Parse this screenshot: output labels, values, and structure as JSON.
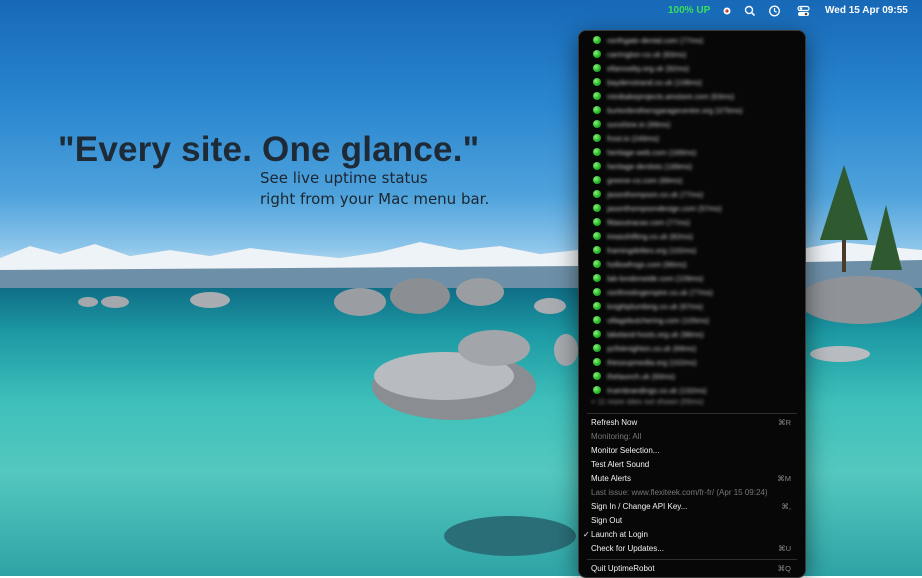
{
  "menubar": {
    "uptime_status": "100% UP",
    "date_time": "Wed 15 Apr  09:55",
    "icons": [
      "app-status-icon",
      "search-icon",
      "time-machine-icon",
      "control-center-icon"
    ]
  },
  "hero": {
    "tagline": "\"Every site. One glance.\"",
    "subline1": "See live uptime status",
    "subline2": "right from your Mac menu bar."
  },
  "monitors": {
    "status_color": "#22c022",
    "sites": [
      "northgate-dental.com (77ms)",
      "carrington-co.uk (83ms)",
      "ellaroseby.org.uk (92ms)",
      "baydenstrand.co.uk (108ms)",
      "minibakeprojects.amstore.com (63ms)",
      "burtonbrothersgaragecentre.org (375ms)",
      "sunshine.io (99ms)",
      "frost.io (249ms)",
      "heritage-web.com (169ms)",
      "heritage-dentists (189ms)",
      "greene-co.com (89ms)",
      "jasonthompson.co.uk (77ms)",
      "jasonthompsondesign.com (57ms)",
      "fittaoutracao.com (77ms)",
      "treasshifting.co.uk (82ms)",
      "framingdelites.org (102ms)",
      "hollowfrogs.com (96ms)",
      "lab-londonwide.com (109ms)",
      "northnotingempire.co.uk (77ms)",
      "knightplumbing.co.uk (97ms)",
      "villagebutchering.com (105ms)",
      "lakeland-hosts.org.uk (98ms)",
      "pcfixknighton.co.uk (69ms)",
      "thesoupmedia.org (102ms)",
      "thelaunch.uk (93ms)",
      "truenbrandings.co.uk (132ms)"
    ],
    "more_text": "+ 11 more sites not shown (55ms)"
  },
  "menu": {
    "refresh": {
      "label": "Refresh Now",
      "shortcut": "⌘R"
    },
    "monitoring": "Monitoring: All",
    "monitor_selection": "Monitor Selection...",
    "test_alert": "Test Alert Sound",
    "mute_alerts": {
      "label": "Mute Alerts",
      "shortcut": "⌘M"
    },
    "last_issue": "Last issue: www.flexiteek.com/fr-fr/ (Apr 15 09:24)",
    "sign_in": {
      "label": "Sign In / Change API Key...",
      "shortcut": "⌘,"
    },
    "sign_out": "Sign Out",
    "launch_at_login": {
      "label": "Launch at Login",
      "check": "✓"
    },
    "check_updates": {
      "label": "Check for Updates...",
      "shortcut": "⌘U"
    },
    "quit": {
      "label": "Quit UptimeRobot",
      "shortcut": "⌘Q"
    }
  }
}
